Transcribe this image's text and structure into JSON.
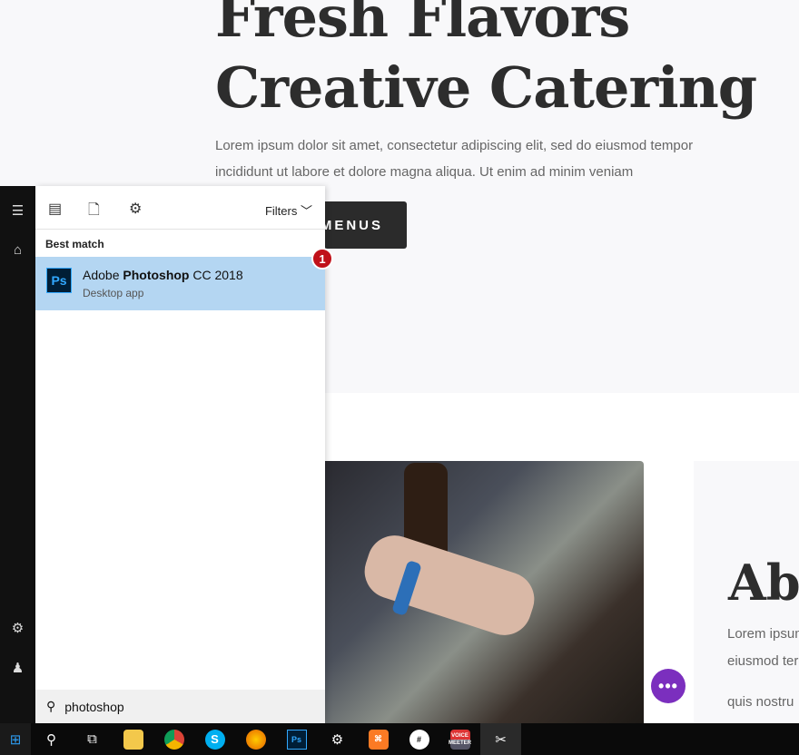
{
  "hero": {
    "title_line1": "Fresh Flavors",
    "title_line2": "Creative Catering",
    "text_line1": "Lorem ipsum dolor sit amet, consectetur adipiscing elit, sed do eiusmod tempor",
    "text_line2": "incididunt ut labore et dolore magna aliqua. Ut enim ad minim veniam",
    "button": "MENUS"
  },
  "about": {
    "title": "Abo",
    "line1": "Lorem ipsum",
    "line2": "eiusmod ter",
    "line3": "quis nostru"
  },
  "fab": {
    "label": "•••",
    "color": "#7b2fbe"
  },
  "start_menu": {
    "filters": "Filters",
    "best_match": "Best match",
    "result_prefix": "Adobe ",
    "result_bold": "Photoshop",
    "result_suffix": " CC 2018",
    "result_sub": "Desktop app",
    "ps_icon": "Ps",
    "badge": "1",
    "search_value": "photoshop",
    "highlight_color": "#b4d6f2"
  },
  "taskbar": {
    "apps": [
      "windows-start",
      "search",
      "task-view",
      "file-explorer",
      "chrome",
      "skype",
      "firefox",
      "photoshop",
      "settings",
      "xampp",
      "slack",
      "voicemeeter",
      "snipping-tool"
    ],
    "ps_label": "Ps",
    "voicemeeter_label": "VOICE MEETER"
  }
}
